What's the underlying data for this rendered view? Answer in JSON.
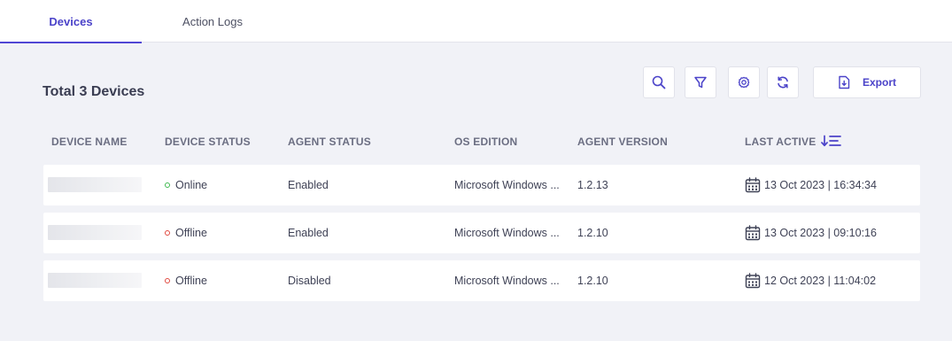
{
  "tabs": [
    {
      "label": "Devices",
      "active": true
    },
    {
      "label": "Action Logs",
      "active": false
    }
  ],
  "summary": {
    "title": "Total 3 Devices"
  },
  "toolbar": {
    "search_icon": "search-icon",
    "filter_icon": "filter-icon",
    "settings_icon": "gear-icon",
    "refresh_icon": "refresh-icon",
    "export_label": "Export"
  },
  "table": {
    "headers": {
      "device_name": "DEVICE NAME",
      "device_status": "DEVICE STATUS",
      "agent_status": "AGENT STATUS",
      "os_edition": "OS EDITION",
      "agent_version": "AGENT VERSION",
      "last_active": "LAST ACTIVE"
    },
    "rows": [
      {
        "device_status": "Online",
        "agent_status": "Enabled",
        "os_edition": "Microsoft Windows ...",
        "agent_version": "1.2.13",
        "last_active": "13 Oct 2023 | 16:34:34"
      },
      {
        "device_status": "Offline",
        "agent_status": "Enabled",
        "os_edition": "Microsoft Windows ...",
        "agent_version": "1.2.10",
        "last_active": "13 Oct 2023 | 09:10:16"
      },
      {
        "device_status": "Offline",
        "agent_status": "Disabled",
        "os_edition": "Microsoft Windows ...",
        "agent_version": "1.2.10",
        "last_active": "12 Oct 2023 | 11:04:02"
      }
    ]
  },
  "colors": {
    "accent": "#5046d4",
    "online": "#3fb950",
    "offline": "#e0483e"
  }
}
